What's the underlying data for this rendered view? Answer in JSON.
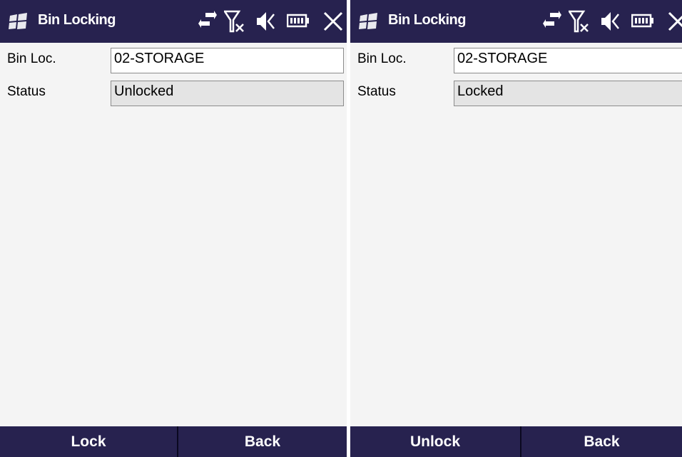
{
  "screens": [
    {
      "title": "Bin Locking",
      "bin_label": "Bin Loc.",
      "bin_value": "02-STORAGE",
      "status_label": "Status",
      "status_value": "Unlocked",
      "softkey_left": "Lock",
      "softkey_right": "Back"
    },
    {
      "title": "Bin Locking",
      "bin_label": "Bin Loc.",
      "bin_value": "02-STORAGE",
      "status_label": "Status",
      "status_value": "Locked",
      "softkey_left": "Unlock",
      "softkey_right": "Back"
    }
  ],
  "icons": {
    "start": "windows-start-icon",
    "sync": "sync-arrows-icon",
    "signal": "no-signal-icon",
    "volume": "speaker-muted-icon",
    "battery": "battery-icon",
    "close": "close-icon"
  },
  "colors": {
    "titlebar": "#27224f",
    "background": "#f4f4f4",
    "readonly_field": "#e4e4e4"
  }
}
